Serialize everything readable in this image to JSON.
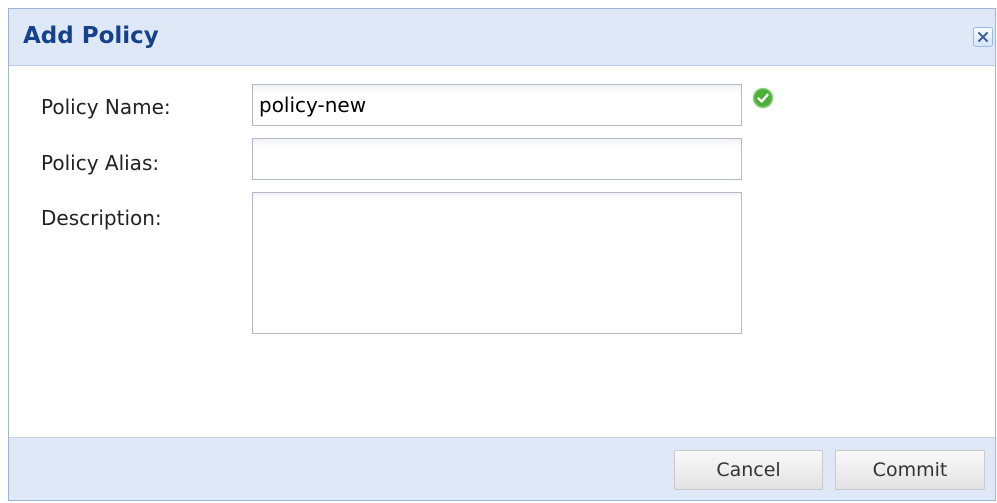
{
  "dialog": {
    "title": "Add Policy"
  },
  "form": {
    "policy_name": {
      "label": "Policy Name:",
      "value": "policy-new",
      "valid": true
    },
    "policy_alias": {
      "label": "Policy Alias:",
      "value": ""
    },
    "description": {
      "label": "Description:",
      "value": ""
    }
  },
  "footer": {
    "cancel_label": "Cancel",
    "commit_label": "Commit"
  },
  "icons": {
    "close": "close-icon",
    "valid": "check-circle-icon"
  },
  "colors": {
    "title_text": "#15428b",
    "header_bg": "#dfe8f6",
    "valid_green": "#4caf3a"
  }
}
